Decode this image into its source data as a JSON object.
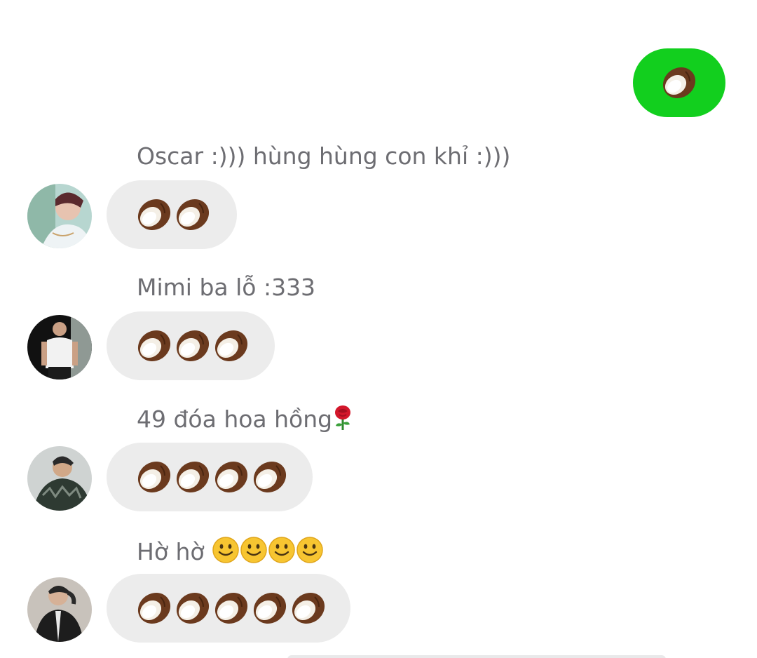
{
  "sent_message": {
    "emoji": [
      "coconut"
    ],
    "bubble_color": "#12cf1e"
  },
  "received_messages": [
    {
      "sender": "Oscar :))) hùng hùng con khỉ :)))",
      "avatar_icon": "avatar-photo",
      "coconut_count": 2
    },
    {
      "sender": "Mimi ba lỗ :333",
      "avatar_icon": "avatar-photo",
      "coconut_count": 3
    },
    {
      "sender": "49 đóa hoa hồng",
      "sender_emoji": "rose",
      "avatar_icon": "avatar-photo",
      "coconut_count": 4
    },
    {
      "sender": "Hờ hờ ",
      "sender_emoji": "slightly-smiling-face",
      "sender_emoji_count": 4,
      "avatar_icon": "avatar-photo",
      "coconut_count": 5
    }
  ],
  "colors": {
    "received_bubble": "#ececec",
    "name_text": "#6d6d72",
    "coconut_shell": "#6b3a1e",
    "coconut_flesh": "#f4efe6"
  }
}
